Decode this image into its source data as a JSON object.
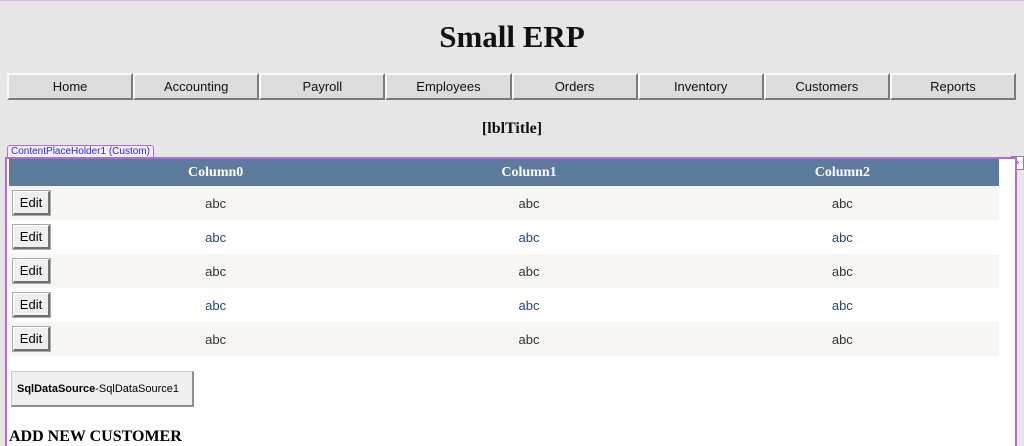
{
  "header": {
    "site_title": "Small ERP"
  },
  "menu": {
    "items": [
      "Home",
      "Accounting",
      "Payroll",
      "Employees",
      "Orders",
      "Inventory",
      "Customers",
      "Reports"
    ]
  },
  "page": {
    "title_label": "[lblTitle]"
  },
  "designer": {
    "placeholder_tag": "ContentPlaceHolder1 (Custom)",
    "expand_glyph": "›"
  },
  "grid": {
    "columns": [
      "Column0",
      "Column1",
      "Column2"
    ],
    "edit_label": "Edit",
    "rows": [
      [
        "abc",
        "abc",
        "abc"
      ],
      [
        "abc",
        "abc",
        "abc"
      ],
      [
        "abc",
        "abc",
        "abc"
      ],
      [
        "abc",
        "abc",
        "abc"
      ],
      [
        "abc",
        "abc",
        "abc"
      ]
    ],
    "colors": {
      "header_bg": "#5d7b9d",
      "alt_row_text": "#284775",
      "row_text": "#333333"
    }
  },
  "datasource": {
    "type_label": "SqlDataSource",
    "separator": " - ",
    "instance_label": "SqlDataSource1"
  },
  "form": {
    "heading": "ADD NEW CUSTOMER"
  }
}
